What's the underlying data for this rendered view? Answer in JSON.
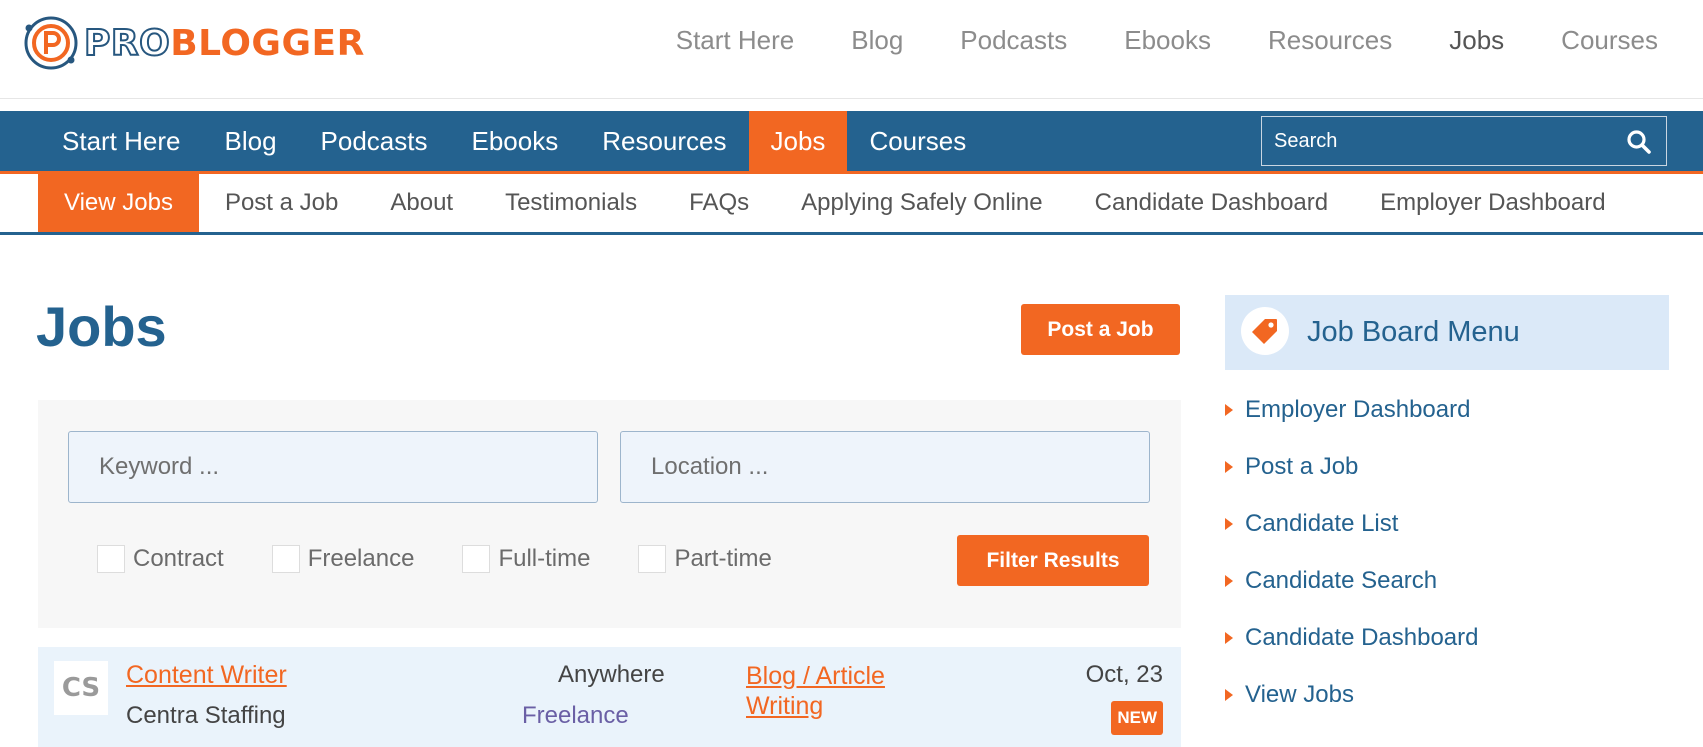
{
  "logo": {
    "text_pro": "PRO",
    "text_blogger": "BLOGGER",
    "ring_color": "#27577f",
    "accent": "#f26722"
  },
  "top_nav": [
    {
      "label": "Start Here",
      "active": false
    },
    {
      "label": "Blog",
      "active": false
    },
    {
      "label": "Podcasts",
      "active": false
    },
    {
      "label": "Ebooks",
      "active": false
    },
    {
      "label": "Resources",
      "active": false
    },
    {
      "label": "Jobs",
      "active": true
    },
    {
      "label": "Courses",
      "active": false
    }
  ],
  "main_nav": {
    "items": [
      {
        "label": "Start Here",
        "active": false
      },
      {
        "label": "Blog",
        "active": false
      },
      {
        "label": "Podcasts",
        "active": false
      },
      {
        "label": "Ebooks",
        "active": false
      },
      {
        "label": "Resources",
        "active": false
      },
      {
        "label": "Jobs",
        "active": true
      },
      {
        "label": "Courses",
        "active": false
      }
    ],
    "search_placeholder": "Search",
    "bar_color": "#24628f"
  },
  "sub_nav": [
    {
      "label": "View Jobs",
      "active": true
    },
    {
      "label": "Post a Job",
      "active": false
    },
    {
      "label": "About",
      "active": false
    },
    {
      "label": "Testimonials",
      "active": false
    },
    {
      "label": "FAQs",
      "active": false
    },
    {
      "label": "Applying Safely Online",
      "active": false
    },
    {
      "label": "Candidate Dashboard",
      "active": false
    },
    {
      "label": "Employer Dashboard",
      "active": false
    }
  ],
  "content": {
    "title": "Jobs",
    "post_job_label": "Post a Job"
  },
  "filters": {
    "keyword_placeholder": "Keyword ...",
    "location_placeholder": "Location ...",
    "job_types": [
      "Contract",
      "Freelance",
      "Full-time",
      "Part-time"
    ],
    "filter_button": "Filter Results"
  },
  "jobs": [
    {
      "logo_text": "CS",
      "title": "Content Writer",
      "company": "Centra Staffing",
      "location": "Anywhere",
      "type": "Freelance",
      "category": "Blog / Article Writing",
      "date": "Oct, 23",
      "badge": "NEW"
    }
  ],
  "sidebar": {
    "title": "Job Board Menu",
    "icon": "tag-icon",
    "items": [
      "Employer Dashboard",
      "Post a Job",
      "Candidate List",
      "Candidate Search",
      "Candidate Dashboard",
      "View Jobs"
    ]
  }
}
